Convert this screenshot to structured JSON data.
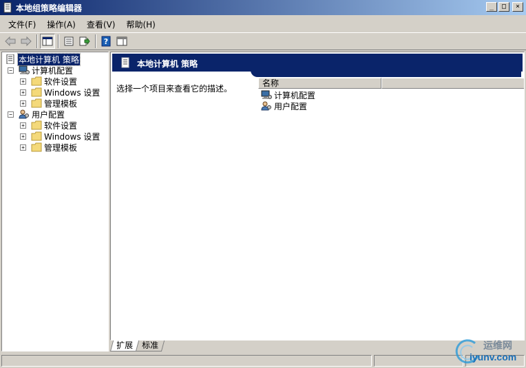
{
  "window": {
    "title": "本地组策略编辑器",
    "buttons": {
      "minimize": "_",
      "maximize": "□",
      "close": "×"
    }
  },
  "menu": [
    "文件(F)",
    "操作(A)",
    "查看(V)",
    "帮助(H)"
  ],
  "toolbar": {
    "buttons": [
      "back-arrow-icon",
      "forward-arrow-icon",
      "show-hide-tree-icon",
      "properties-icon",
      "export-list-icon",
      "help-icon",
      "show-hide-action-pane-icon"
    ]
  },
  "tree": {
    "root": "本地计算机 策略",
    "computer": {
      "label": "计算机配置",
      "children": [
        "软件设置",
        "Windows 设置",
        "管理模板"
      ]
    },
    "user": {
      "label": "用户配置",
      "children": [
        "软件设置",
        "Windows 设置",
        "管理模板"
      ]
    }
  },
  "content": {
    "title": "本地计算机 策略",
    "description": "选择一个项目来查看它的描述。",
    "column_name": "名称",
    "items": [
      "计算机配置",
      "用户配置"
    ]
  },
  "tabs": [
    "扩展",
    "标准"
  ],
  "watermark": {
    "line1": "运维网",
    "line2": "iyunv.com"
  }
}
